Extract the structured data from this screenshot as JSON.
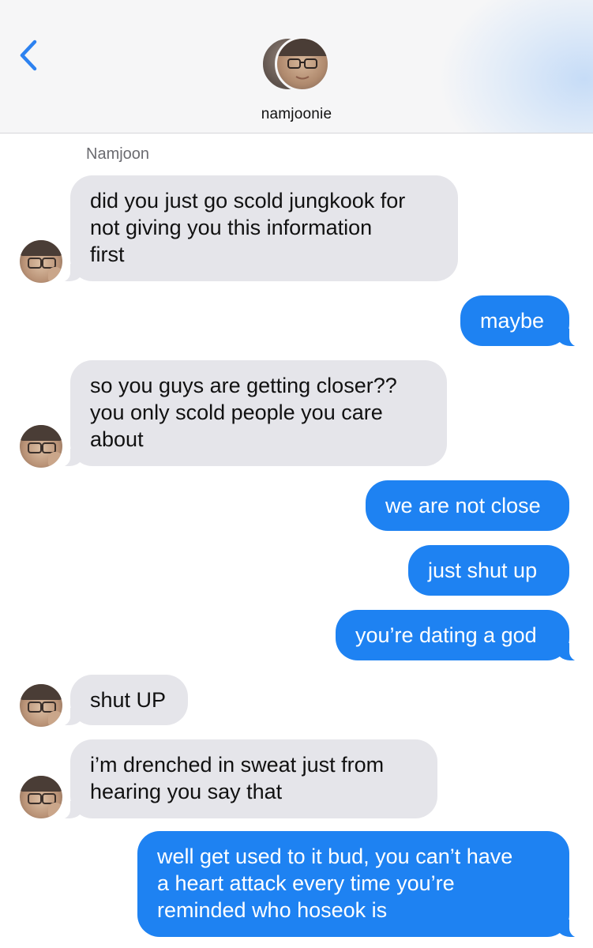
{
  "header": {
    "contact_name": "namjoonie"
  },
  "conversation": {
    "sender_label": "Namjoon",
    "messages": [
      {
        "from": "them",
        "text": "did you just go scold jungkook for\nnot giving you this information\nfirst"
      },
      {
        "from": "me",
        "text": "maybe"
      },
      {
        "from": "them",
        "text": "so you guys are getting closer??\nyou only scold people you care\nabout"
      },
      {
        "from": "me",
        "text": "we are not close"
      },
      {
        "from": "me",
        "text": "just shut up"
      },
      {
        "from": "me",
        "text": "you’re dating a god"
      },
      {
        "from": "them",
        "text": "shut UP"
      },
      {
        "from": "them",
        "text": "i’m drenched in sweat just from\nhearing you say that"
      },
      {
        "from": "me",
        "text": "well get used to it bud, you can’t have\na heart attack every time you’re\nreminded who hoseok is"
      }
    ]
  },
  "colors": {
    "accent": "#1e82f2",
    "incoming_bubble": "#e5e5ea",
    "back_chevron": "#2d82f0"
  }
}
